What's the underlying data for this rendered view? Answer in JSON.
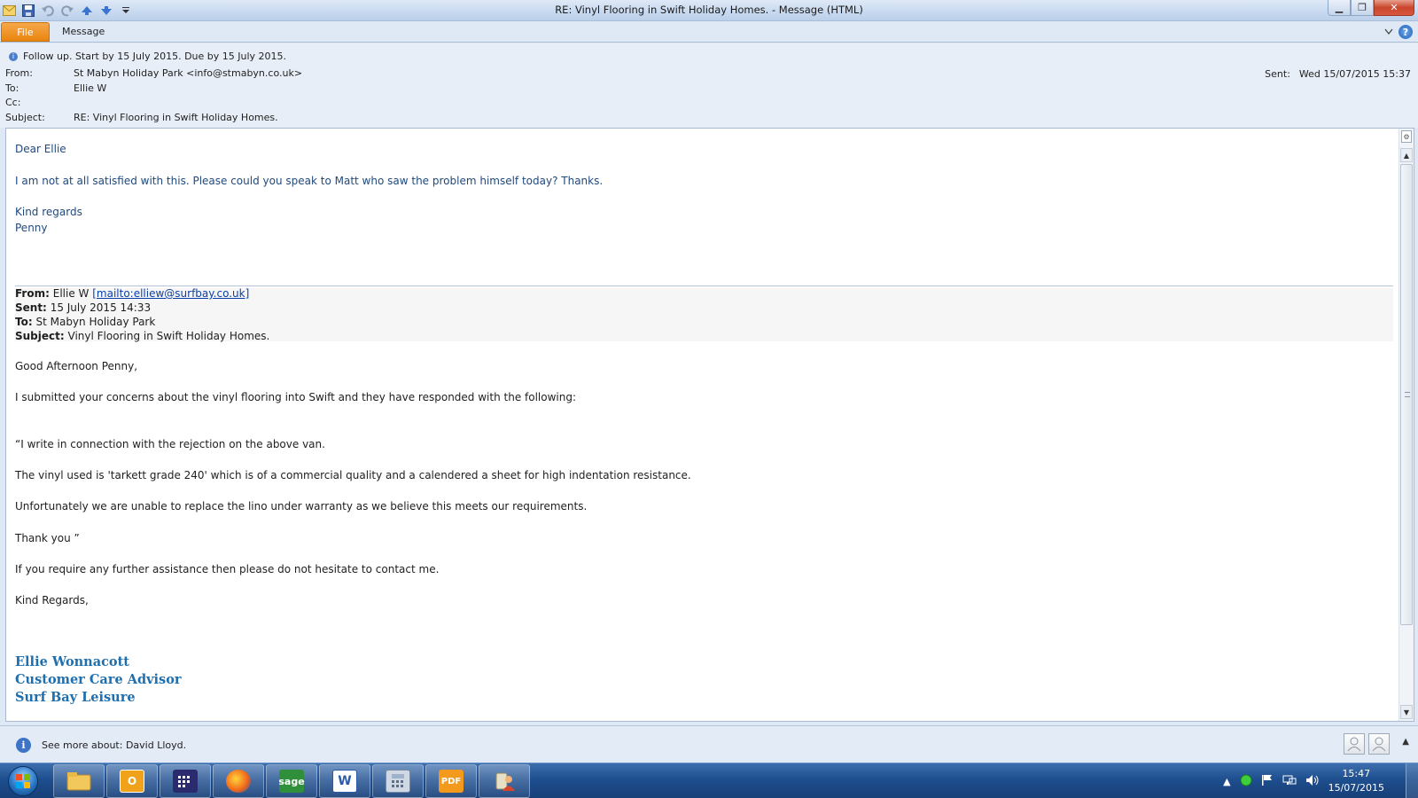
{
  "window": {
    "title": "RE: Vinyl Flooring in Swift Holiday Homes.  -  Message (HTML)"
  },
  "ribbon": {
    "tabs": [
      {
        "label": "File"
      },
      {
        "label": "Message"
      }
    ]
  },
  "header": {
    "followup": "Follow up.  Start by 15 July 2015.  Due by 15 July 2015.",
    "from_label": "From:",
    "from_value": "St Mabyn Holiday Park <info@stmabyn.co.uk>",
    "to_label": "To:",
    "to_value": "Ellie W",
    "cc_label": "Cc:",
    "cc_value": "",
    "subject_label": "Subject:",
    "subject_value": "RE: Vinyl Flooring in Swift Holiday Homes.",
    "sent_label": "Sent:",
    "sent_value": "Wed 15/07/2015 15:37"
  },
  "body": {
    "greeting": "Dear Ellie",
    "reply": "I am not at all satisfied with this.  Please could you speak to Matt who saw the problem himself today?  Thanks.",
    "closing": "Kind regards",
    "name": "Penny",
    "quoted": {
      "from_label": "From:",
      "from_name": "Ellie W",
      "from_link": "[mailto:elliew@surfbay.co.uk]",
      "sent_label": "Sent:",
      "sent_value": "15 July 2015 14:33",
      "to_label": "To:",
      "to_value": "St Mabyn Holiday Park",
      "subject_label": "Subject:",
      "subject_value": "Vinyl Flooring in Swift Holiday Homes."
    },
    "lines": [
      "Good Afternoon Penny,",
      "I submitted your concerns about the vinyl flooring into Swift and they have responded with the following:",
      "“I write in connection with the rejection on the above van.",
      "The vinyl used is 'tarkett grade 240' which is of a commercial quality and a calendered a sheet for high indentation resistance.",
      "Unfortunately we are unable to replace the lino under warranty as we believe this meets our requirements.",
      "Thank you ”",
      "If you require any further assistance then please do not hesitate to contact me.",
      "Kind Regards,"
    ],
    "signature": [
      "Ellie Wonnacott",
      "Customer Care Advisor",
      "Surf Bay Leisure"
    ]
  },
  "people_pane": {
    "text": "See more about: David Lloyd."
  },
  "taskbar": {
    "apps": [
      {
        "icon": "file-explorer-icon"
      },
      {
        "icon": "outlook-icon"
      },
      {
        "icon": "calendar-app-icon"
      },
      {
        "icon": "firefox-icon"
      },
      {
        "icon": "sage-icon",
        "label": "sage"
      },
      {
        "icon": "word-icon",
        "label": "W"
      },
      {
        "icon": "calculator-icon"
      },
      {
        "icon": "pdf-icon",
        "label": "PDF"
      },
      {
        "icon": "users-app-icon"
      }
    ],
    "time": "15:47",
    "date": "15/07/2015"
  },
  "colors": {
    "file_tab": "#e9850f",
    "body_blue": "#1f497d",
    "signature_blue": "#1f6fae",
    "link": "#0b3fa8"
  }
}
